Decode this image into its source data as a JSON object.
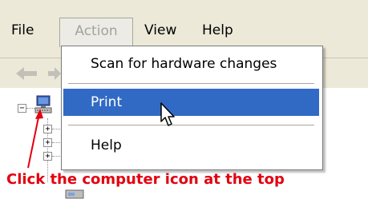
{
  "menubar": {
    "items": [
      {
        "label": "File"
      },
      {
        "label": "Action"
      },
      {
        "label": "View"
      },
      {
        "label": "Help"
      }
    ]
  },
  "action_menu": {
    "items": [
      {
        "label": "Scan for hardware changes"
      },
      {
        "label": "Print",
        "highlighted": true
      },
      {
        "label": "Help"
      }
    ]
  },
  "tree": {
    "expanders": [
      "−",
      "+",
      "+",
      "+"
    ]
  },
  "annotation": {
    "text": "Click the computer icon at the top",
    "color": "#e3000f"
  },
  "colors": {
    "menu_bg": "#ece9d8",
    "highlight": "#316ac5"
  },
  "icons": [
    "back-arrow-icon",
    "forward-arrow-icon",
    "computer-icon",
    "device-icon",
    "mouse-cursor-icon",
    "red-arrow-icon"
  ]
}
